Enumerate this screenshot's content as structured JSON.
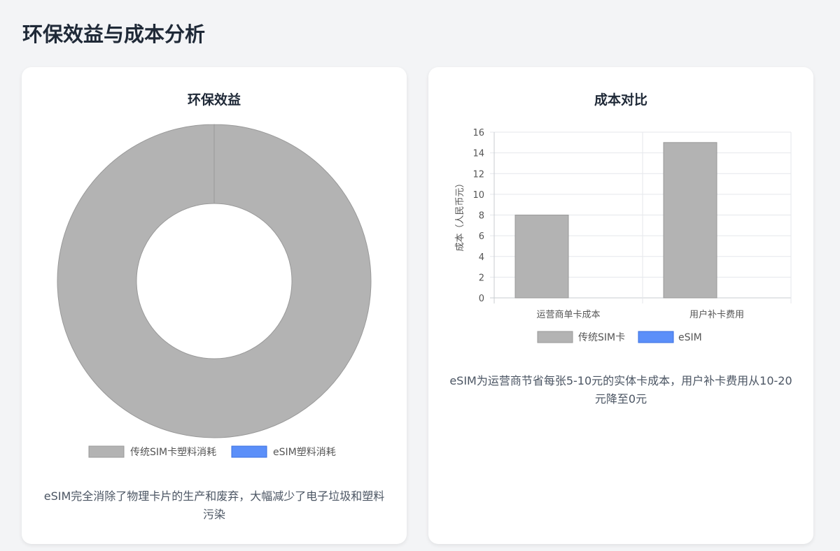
{
  "page": {
    "title": "环保效益与成本分析"
  },
  "cards": {
    "environment": {
      "title": "环保效益",
      "description": "eSIM完全消除了物理卡片的生产和废弃，大幅减少了电子垃圾和塑料污染"
    },
    "cost": {
      "title": "成本对比",
      "description": "eSIM为运营商节省每张5-10元的实体卡成本，用户补卡费用从10-20元降至0元"
    }
  },
  "colors": {
    "traditional_sim": "#b3b3b3",
    "esim": "#5b8ff9",
    "traditional_border": "#999999",
    "esim_border": "#3a6fe0",
    "grid": "#e5e7eb"
  },
  "chart_data": [
    {
      "type": "pie",
      "variant": "doughnut",
      "title": "环保效益",
      "labels": [
        "传统SIM卡塑料消耗",
        "eSIM塑料消耗"
      ],
      "values": [
        100,
        0
      ],
      "legend_position": "bottom"
    },
    {
      "type": "bar",
      "title": "成本对比",
      "categories": [
        "运营商单卡成本",
        "用户补卡费用"
      ],
      "series": [
        {
          "name": "传统SIM卡",
          "values": [
            8,
            15
          ]
        },
        {
          "name": "eSIM",
          "values": [
            0,
            0
          ]
        }
      ],
      "ylabel": "成本（人民币元）",
      "ylim": [
        0,
        16
      ],
      "yticks": [
        0,
        2,
        4,
        6,
        8,
        10,
        12,
        14,
        16
      ],
      "grid": true,
      "legend_position": "bottom"
    }
  ]
}
